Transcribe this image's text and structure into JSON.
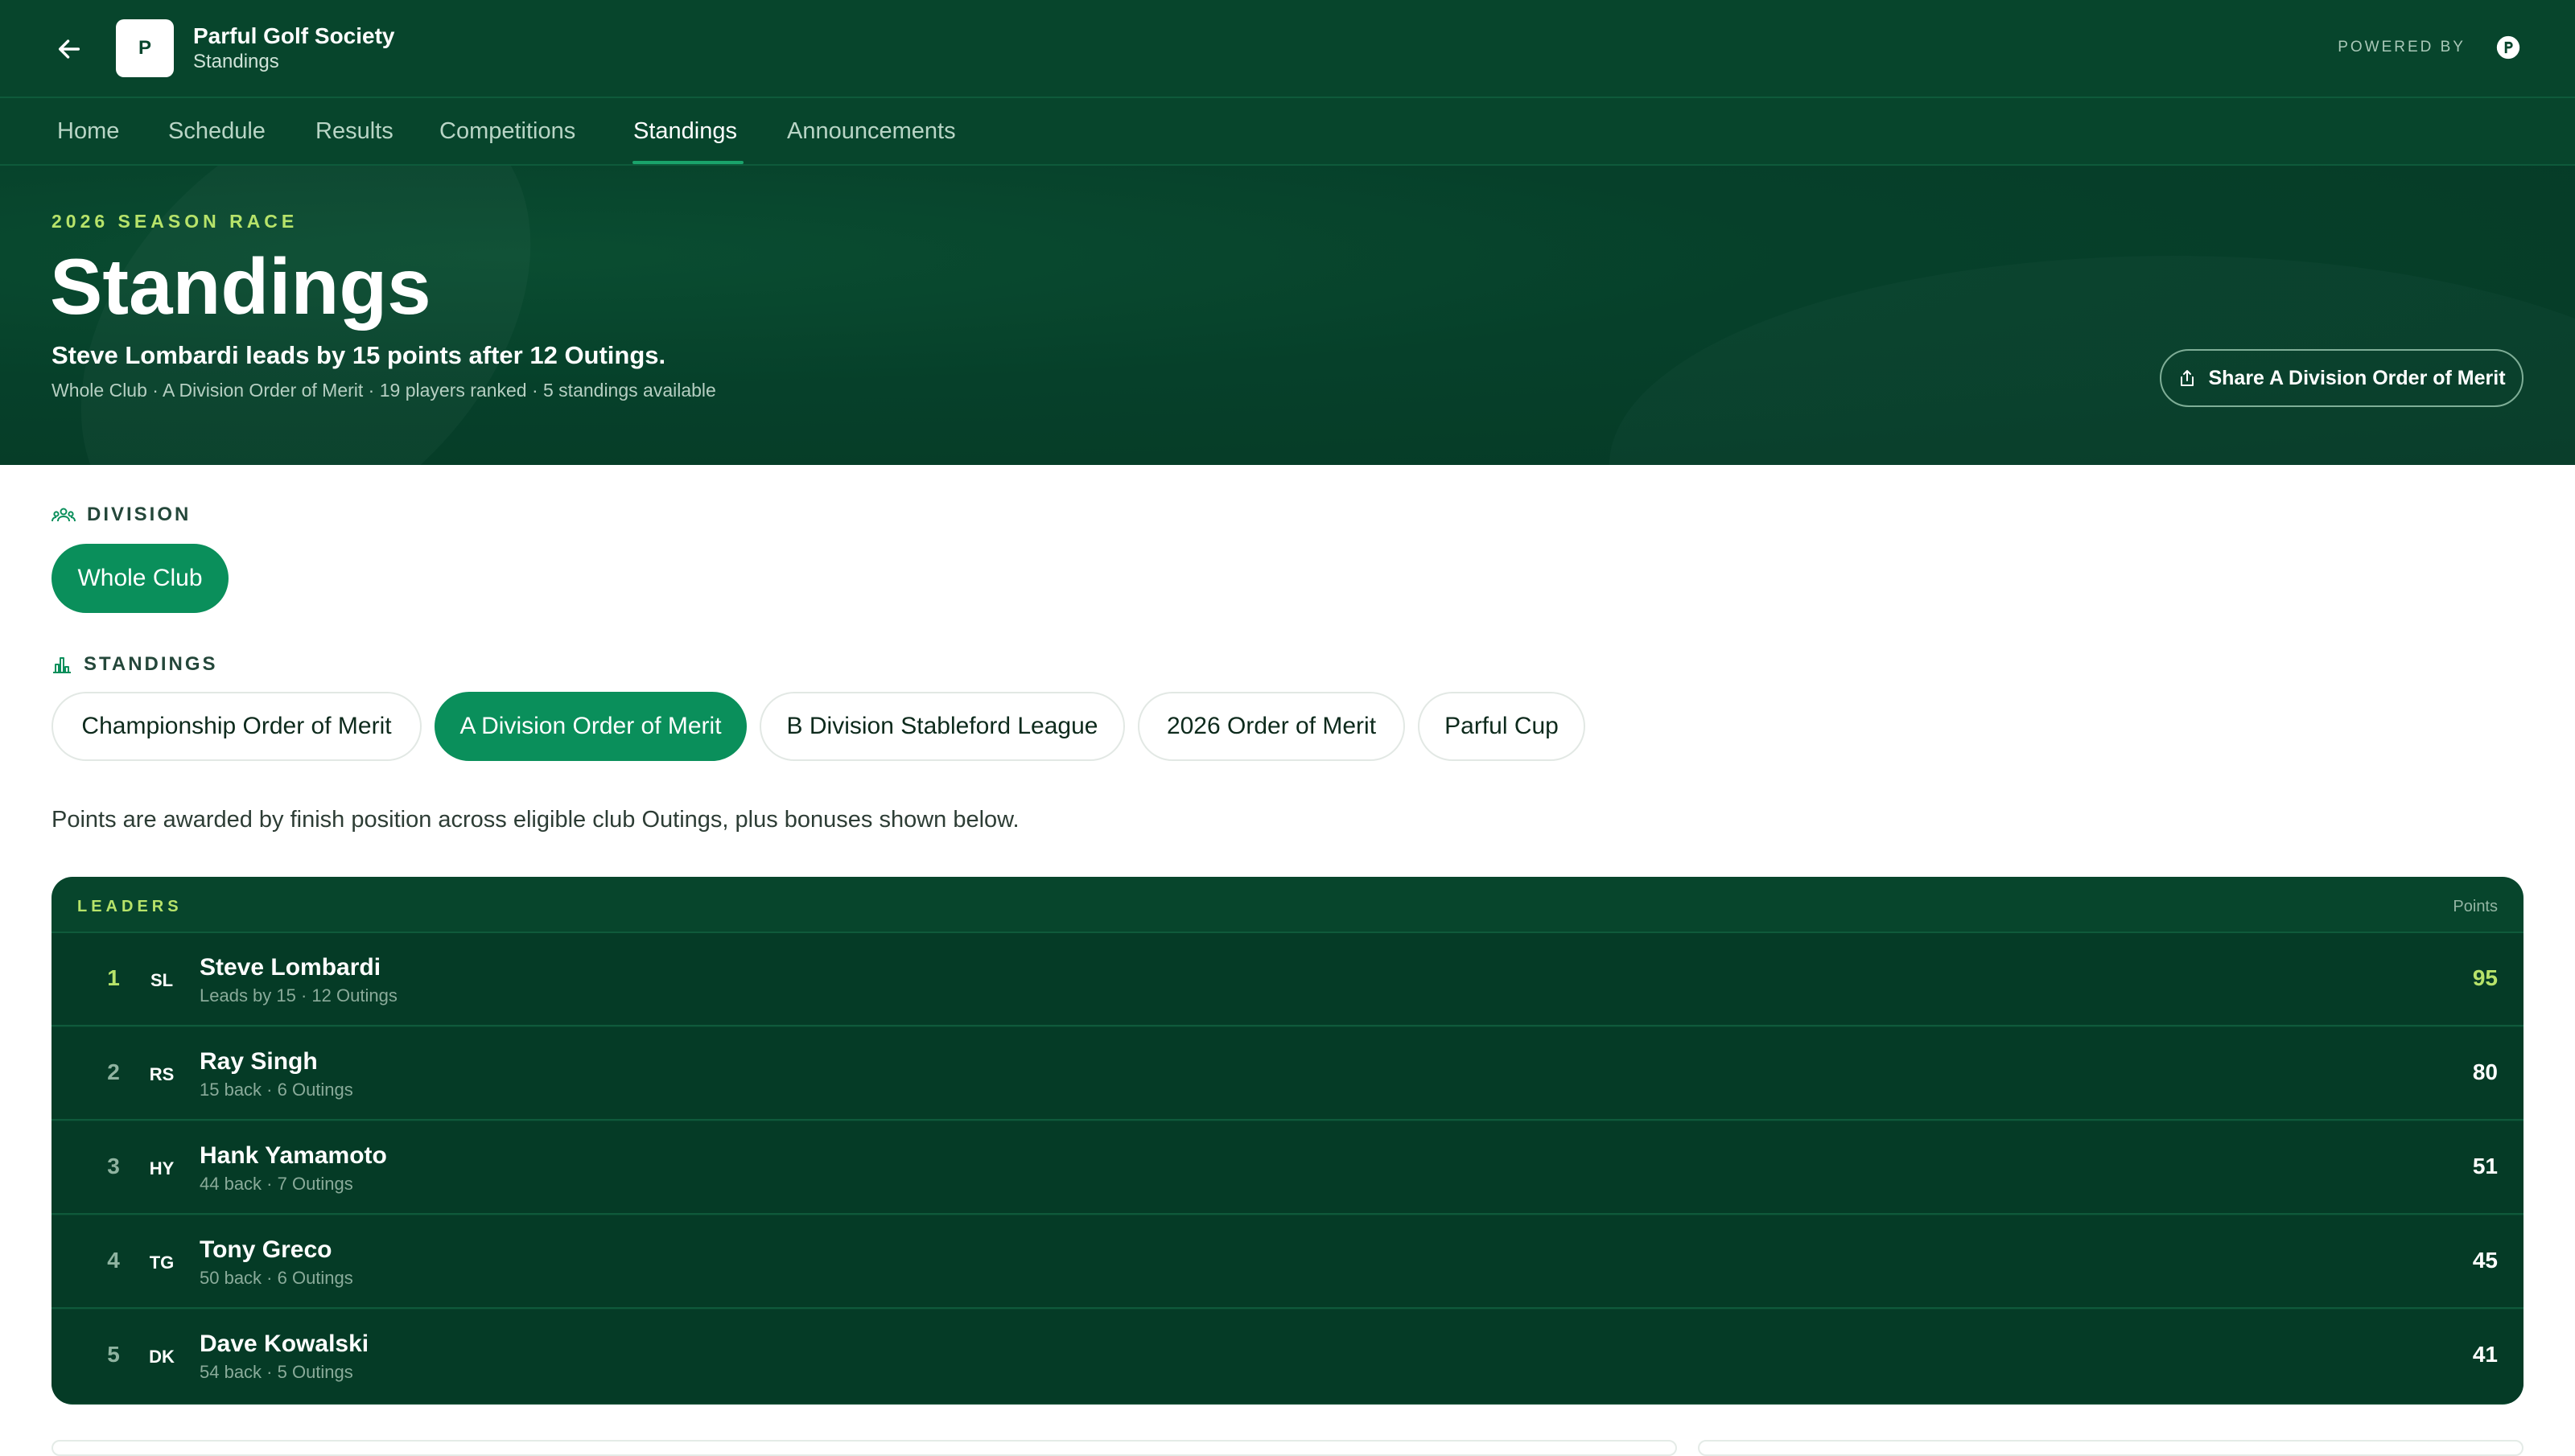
{
  "header": {
    "logo_letter": "P",
    "org_name": "Parful Golf Society",
    "org_sub": "Standings",
    "powered_by": "POWERED BY"
  },
  "nav": {
    "items": [
      "Home",
      "Schedule",
      "Results",
      "Competitions",
      "Standings",
      "Announcements"
    ],
    "active": "Standings"
  },
  "hero": {
    "eyebrow": "2026 SEASON RACE",
    "title": "Standings",
    "lead": "Steve Lombardi leads by 15 points after 12 Outings.",
    "meta": "Whole Club · A Division Order of Merit · 19 players ranked · 5 standings available",
    "share_label": "Share A Division Order of Merit"
  },
  "division": {
    "label": "DIVISION",
    "options": [
      "Whole Club"
    ],
    "selected": "Whole Club"
  },
  "standings": {
    "label": "STANDINGS",
    "options": [
      "Championship Order of Merit",
      "A Division Order of Merit",
      "B Division Stableford League",
      "2026 Order of Merit",
      "Parful Cup"
    ],
    "selected": "A Division Order of Merit"
  },
  "note": "Points are awarded by finish position across eligible club Outings, plus bonuses shown below.",
  "leaders": {
    "title": "LEADERS",
    "points_header": "Points",
    "rows": [
      {
        "rank": "1",
        "initials": "SL",
        "name": "Steve Lombardi",
        "sub": "Leads by 15 · 12 Outings",
        "points": "95"
      },
      {
        "rank": "2",
        "initials": "RS",
        "name": "Ray Singh",
        "sub": "15 back · 6 Outings",
        "points": "80"
      },
      {
        "rank": "3",
        "initials": "HY",
        "name": "Hank Yamamoto",
        "sub": "44 back · 7 Outings",
        "points": "51"
      },
      {
        "rank": "4",
        "initials": "TG",
        "name": "Tony Greco",
        "sub": "50 back · 6 Outings",
        "points": "45"
      },
      {
        "rank": "5",
        "initials": "DK",
        "name": "Dave Kowalski",
        "sub": "54 back · 5 Outings",
        "points": "41"
      }
    ]
  },
  "colors": {
    "brand_dark": "#07452c",
    "accent_green": "#0a8f5b",
    "highlight_lime": "#b7e36a"
  },
  "icons": {
    "back": "arrow-left-icon",
    "powered": "brand-logo-icon",
    "share": "share-icon",
    "division": "people-icon",
    "standings": "bar-chart-icon"
  }
}
